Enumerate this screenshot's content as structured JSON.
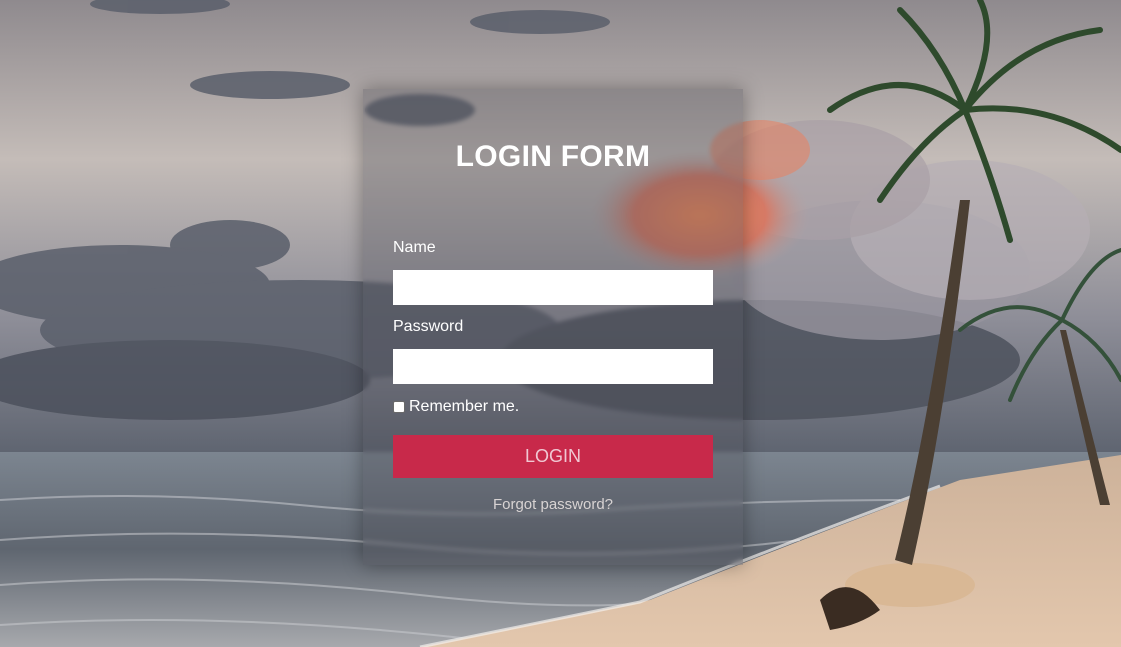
{
  "login_form": {
    "title": "LOGIN FORM",
    "name_label": "Name",
    "name_value": "",
    "password_label": "Password",
    "password_value": "",
    "remember_label": "Remember me.",
    "remember_checked": false,
    "login_button": "LOGIN",
    "forgot_link": "Forgot password?"
  },
  "colors": {
    "login_button": "#c8294a",
    "panel_overlay": "rgba(70,70,80,0.32)",
    "sky": "#b7a8a6",
    "sea": "#6f7680",
    "sand": "#d8b89a"
  },
  "background": {
    "subject": "beach-with-palm-trees"
  }
}
